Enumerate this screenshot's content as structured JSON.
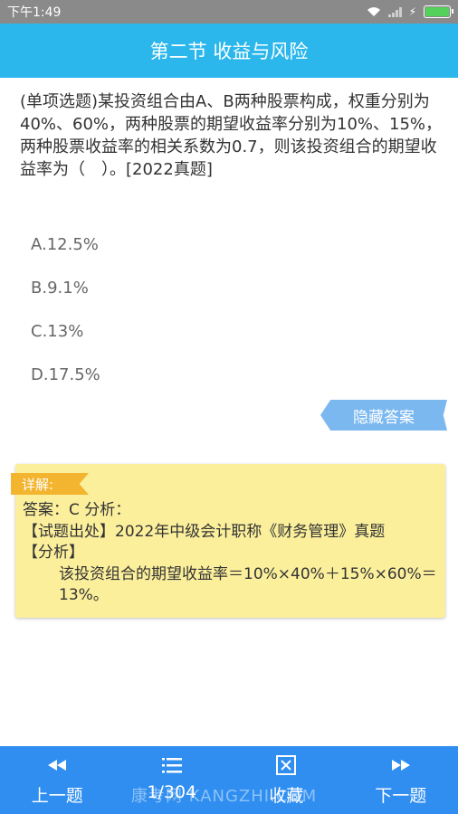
{
  "status_bar": {
    "time": "下午1:49"
  },
  "header": {
    "title": "第二节 收益与风险"
  },
  "question": {
    "text": "(单项选题)某投资组合由A、B两种股票构成，权重分别为40%、60%，两种股票的期望收益率分别为10%、15%，两种股票收益率的相关系数为0.7，则该投资组合的期望收益率为（　）。[2022真题]"
  },
  "options": [
    {
      "label": "A.12.5%"
    },
    {
      "label": "B.9.1%"
    },
    {
      "label": "C.13%"
    },
    {
      "label": "D.17.5%"
    }
  ],
  "hide_answer_label": "隐藏答案",
  "explanation": {
    "tag": "详解:",
    "line1": "答案：C 分析：",
    "line2": "【试题出处】2022年中级会计职称《财务管理》真题",
    "line3": "【分析】",
    "line4": "该投资组合的期望收益率＝10%×40%＋15%×60%＝13%。"
  },
  "bottom_nav": {
    "prev": "上一题",
    "progress": "1/304",
    "favorite": "收藏",
    "next": "下一题"
  },
  "watermark": "康考网 KANGZHI.COM",
  "colors": {
    "header": "#2bb7ec",
    "bottom_bar": "#2f8ef0",
    "explain_bg": "#fbef9c",
    "explain_tag": "#f3b530",
    "hide_answer": "#7bb8f0"
  }
}
